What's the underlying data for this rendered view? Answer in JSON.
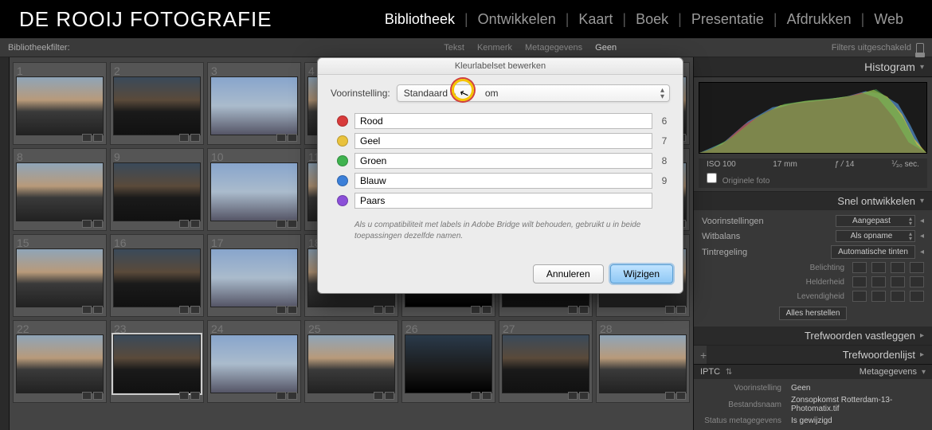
{
  "brand": "DE ROOIJ FOTOGRAFIE",
  "nav": {
    "items": [
      "Bibliotheek",
      "Ontwikkelen",
      "Kaart",
      "Boek",
      "Presentatie",
      "Afdrukken",
      "Web"
    ],
    "active_index": 0
  },
  "filterbar": {
    "label": "Bibliotheekfilter:",
    "tabs": [
      "Tekst",
      "Kenmerk",
      "Metagegevens",
      "Geen"
    ],
    "active_tab": 3,
    "right_text": "Filters uitgeschakeld"
  },
  "grid": {
    "count": 28,
    "selected_index": 22
  },
  "right": {
    "histogram_title": "Histogram",
    "histo_info": {
      "iso": "ISO 100",
      "focal": "17 mm",
      "aperture_prefix": "ƒ /",
      "aperture": "14",
      "shutter": "⅟₃₀ sec."
    },
    "original_checkbox": "Originele foto",
    "quick_dev_title": "Snel ontwikkelen",
    "presets_label": "Voorinstellingen",
    "presets_value": "Aangepast",
    "wb_label": "Witbalans",
    "wb_value": "Als opname",
    "tone_label": "Tintregeling",
    "tone_button": "Automatische tinten",
    "exposure": "Belichting",
    "brightness": "Helderheid",
    "vibrance": "Levendigheid",
    "reset_all": "Alles herstellen",
    "keywords_set": "Trefwoorden vastleggen",
    "keywords_list": "Trefwoordenlijst",
    "iptc_label": "IPTC",
    "metadata_title": "Metagegevens",
    "meta_rows": [
      {
        "k": "Voorinstelling",
        "v": "Geen"
      },
      {
        "k": "Bestandsnaam",
        "v": "Zonsopkomst Rotterdam-13-Photomatix.tif"
      },
      {
        "k": "Status metagegevens",
        "v": "Is gewijzigd"
      }
    ]
  },
  "dialog": {
    "title": "Kleurlabelset bewerken",
    "preset_label": "Voorinstelling:",
    "preset_value_prefix": "Standaard – ",
    "preset_value_suffix": "om",
    "colors": [
      {
        "name": "Rood",
        "hex": "#d83b3b",
        "shortcut": "6"
      },
      {
        "name": "Geel",
        "hex": "#e9c23c",
        "shortcut": "7"
      },
      {
        "name": "Groen",
        "hex": "#3fb24f",
        "shortcut": "8"
      },
      {
        "name": "Blauw",
        "hex": "#3b7fd8",
        "shortcut": "9"
      },
      {
        "name": "Paars",
        "hex": "#8b4fd8",
        "shortcut": ""
      }
    ],
    "hint": "Als u compatibiliteit met labels in Adobe Bridge wilt behouden, gebruikt u in beide toepassingen dezelfde namen.",
    "cancel": "Annuleren",
    "confirm": "Wijzigen"
  }
}
